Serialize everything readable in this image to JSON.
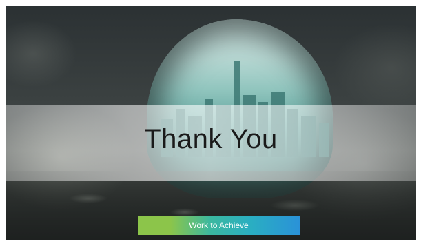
{
  "slide": {
    "title": "Thank You",
    "button_label": "Work to Achieve",
    "colors": {
      "button_green": "#8cc54a",
      "button_teal": "#2aaec2",
      "button_blue": "#2a92d8",
      "title_text": "#1a1a1a"
    }
  }
}
